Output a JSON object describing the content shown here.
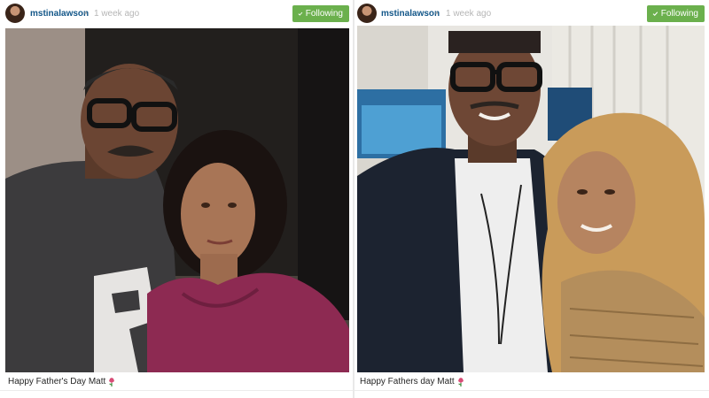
{
  "posts": [
    {
      "username": "mstinalawson",
      "separator": "•",
      "time": "1 week ago",
      "follow_label": "Following",
      "caption": "Happy Father's Day Matt"
    },
    {
      "username": "mstinalawson",
      "separator": "•",
      "time": "1 week ago",
      "follow_label": "Following",
      "caption": "Happy Fathers day Matt"
    }
  ],
  "colors": {
    "username": "#125688",
    "follow_button": "#6bb04d",
    "muted": "#b6b6b6"
  },
  "icons": [
    "avatar",
    "check-icon",
    "flower-icon"
  ]
}
